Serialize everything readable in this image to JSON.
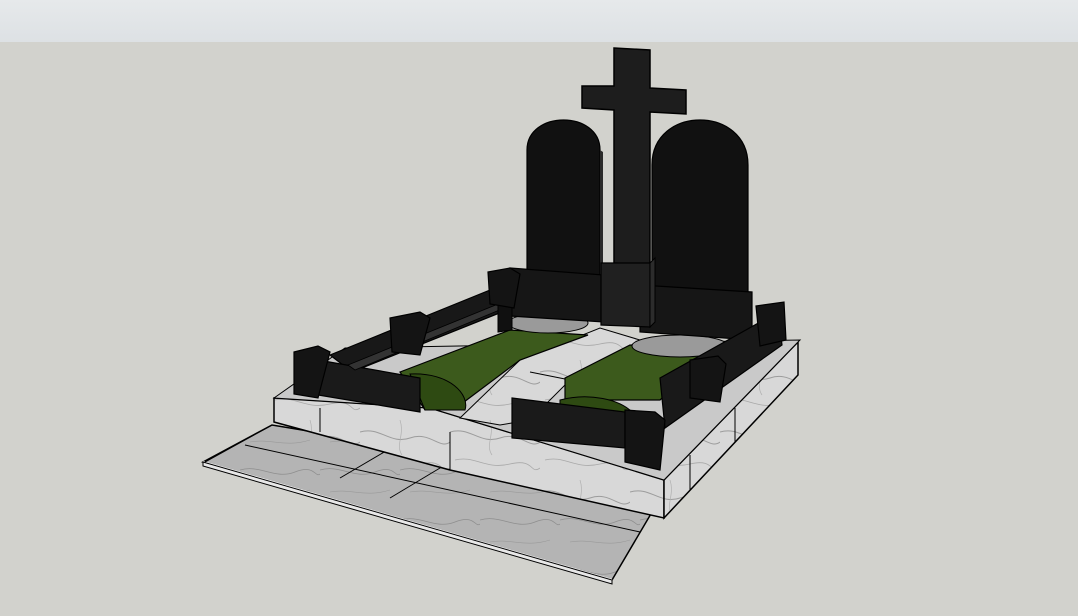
{
  "viewport": {
    "sky_color": "#e6e9eb",
    "ground_color": "#d2d2cd"
  },
  "model": {
    "objects": [
      "concrete-front-step",
      "marble-plinth",
      "marble-walkway",
      "left-grass-bed",
      "right-grass-bed",
      "left-arched-headstone",
      "right-arched-headstone",
      "center-cross",
      "black-border-curbs",
      "corner-posts"
    ],
    "colors": {
      "granite_black": "#121212",
      "granite_edge": "#2a2a2a",
      "marble_light": "#dcdcdc",
      "marble_vein": "#9a9a9a",
      "concrete": "#bcbcbc",
      "grass": "#3c5a1c",
      "outline": "#000000"
    }
  }
}
